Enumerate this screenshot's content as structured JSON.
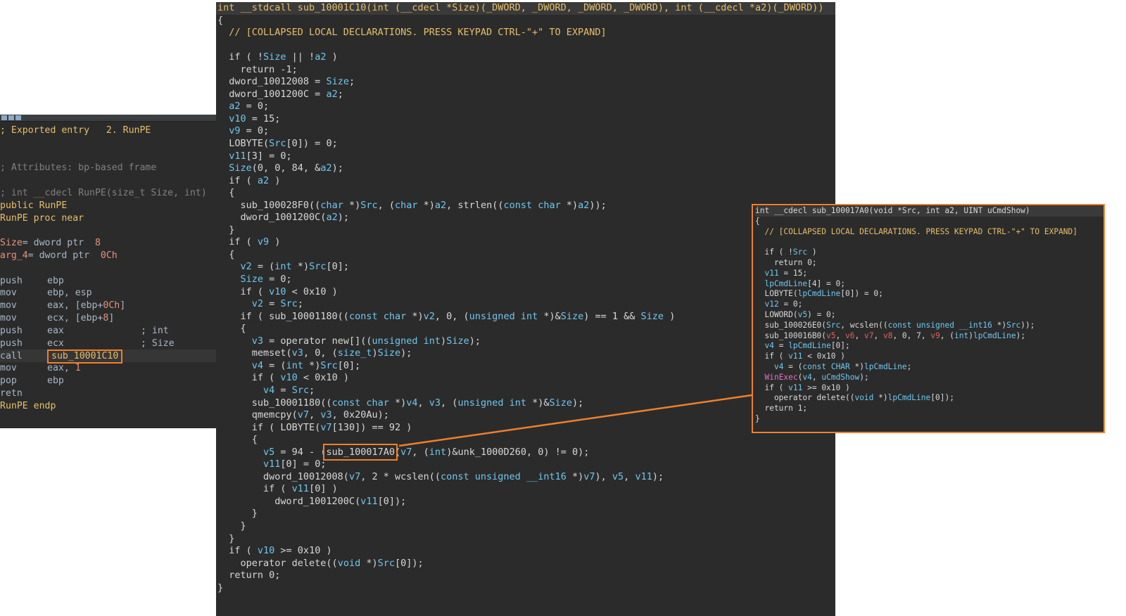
{
  "asm": {
    "l1": "; Exported entry   2. RunPE",
    "l2": "; Attributes: bp-based frame",
    "l3": "; int __cdecl RunPE(size_t Size, int)",
    "l4_kw": "public",
    "l4_name": "RunPE",
    "l5_name": "RunPE",
    "l5_rest": "proc near",
    "l6_var": "Size",
    "l6_mid": "= dword ptr  ",
    "l6_num": "8",
    "l7_var": "arg_4",
    "l7_mid": "= dword ptr  ",
    "l7_num": "0Ch",
    "i1_m": "push",
    "i1_o": "ebp",
    "i2_m": "mov",
    "i2_o": "ebp, esp",
    "i3_m": "mov",
    "i3_o1": "eax, [ebp+",
    "i3_n": "0Ch",
    "i3_o2": "]",
    "i4_m": "mov",
    "i4_o1": "ecx, [ebp+",
    "i4_n": "8",
    "i4_o2": "]",
    "i5_m": "push",
    "i5_o": "eax",
    "i5_c": "; int",
    "i6_m": "push",
    "i6_o": "ecx",
    "i6_c": "; Size",
    "i7_m": "call",
    "i7_o": "sub_10001C10",
    "i8_m": "mov",
    "i8_o": "eax, ",
    "i8_n": "1",
    "i9_m": "pop",
    "i9_o": "ebp",
    "i10_m": "retn",
    "end_name": "RunPE",
    "end_kw": "endp"
  },
  "main": {
    "sig": "int __stdcall sub_10001C10(int (__cdecl *Size)(_DWORD, _DWORD, _DWORD, _DWORD), int (__cdecl *a2)(_DWORD))",
    "lines": [
      "{",
      "  // [COLLAPSED LOCAL DECLARATIONS. PRESS KEYPAD CTRL-\"+\" TO EXPAND]",
      "",
      "  if ( !Size || !a2 )",
      "    return -1;",
      "  dword_10012008 = Size;",
      "  dword_1001200C = a2;",
      "  a2 = 0;",
      "  v10 = 15;",
      "  v9 = 0;",
      "  LOBYTE(Src[0]) = 0;",
      "  v11[3] = 0;",
      "  Size(0, 0, 84, &a2);",
      "  if ( a2 )",
      "  {",
      "    sub_100028F0((char *)Src, (char *)a2, strlen((const char *)a2));",
      "    dword_1001200C(a2);",
      "  }",
      "  if ( v9 )",
      "  {",
      "    v2 = (int *)Src[0];",
      "    Size = 0;",
      "    if ( v10 < 0x10 )",
      "      v2 = Src;",
      "    if ( sub_10001180((const char *)v2, 0, (unsigned int *)&Size) == 1 && Size )",
      "    {",
      "      v3 = operator new[]((unsigned int)Size);",
      "      memset(v3, 0, (size_t)Size);",
      "      v4 = (int *)Src[0];",
      "      if ( v10 < 0x10 )",
      "        v4 = Src;",
      "      sub_10001180((const char *)v4, v3, (unsigned int *)&Size);",
      "      qmemcpy(v7, v3, 0x20Au);",
      "      if ( LOBYTE(v7[130]) == 92 )",
      "      {",
      "        v5 = 94 - (sub_100017A0(v7, (int)&unk_1000D260, 0) != 0);",
      "        v11[0] = 0;",
      "        dword_10012008(v7, 2 * wcslen((const unsigned __int16 *)v7), v5, v11);",
      "        if ( v11[0] )",
      "          dword_1001200C(v11[0]);",
      "      }",
      "    }",
      "  }",
      "  if ( v10 >= 0x10 )",
      "    operator delete((void *)Src[0]);",
      "  return 0;",
      "}"
    ]
  },
  "popup": {
    "sig": "int __cdecl sub_100017A0(void *Src, int a2, UINT uCmdShow)",
    "lines": [
      "{",
      "  // [COLLAPSED LOCAL DECLARATIONS. PRESS KEYPAD CTRL-\"+\" TO EXPAND]",
      "",
      "  if ( !Src )",
      "    return 0;",
      "  v11 = 15;",
      "  lpCmdLine[4] = 0;",
      "  LOBYTE(lpCmdLine[0]) = 0;",
      "  v12 = 0;",
      "  LOWORD(v5) = 0;",
      "  sub_100026E0(Src, wcslen((const unsigned __int16 *)Src));",
      "  sub_100016B0(v5, v6, v7, v8, 0, 7, v9, (int)lpCmdLine);",
      "  v4 = lpCmdLine[0];",
      "  if ( v11 < 0x10 )",
      "    v4 = (const CHAR *)lpCmdLine;",
      "  WinExec(v4, uCmdShow);",
      "  if ( v11 >= 0x10 )",
      "    operator delete((void *)lpCmdLine[0]);",
      "  return 1;",
      "}"
    ]
  },
  "colors": {
    "accent": "#f0802a",
    "panel_bg": "#2b2b2b",
    "variable": "#6ec8f0",
    "comment": "#e8bf6a"
  }
}
